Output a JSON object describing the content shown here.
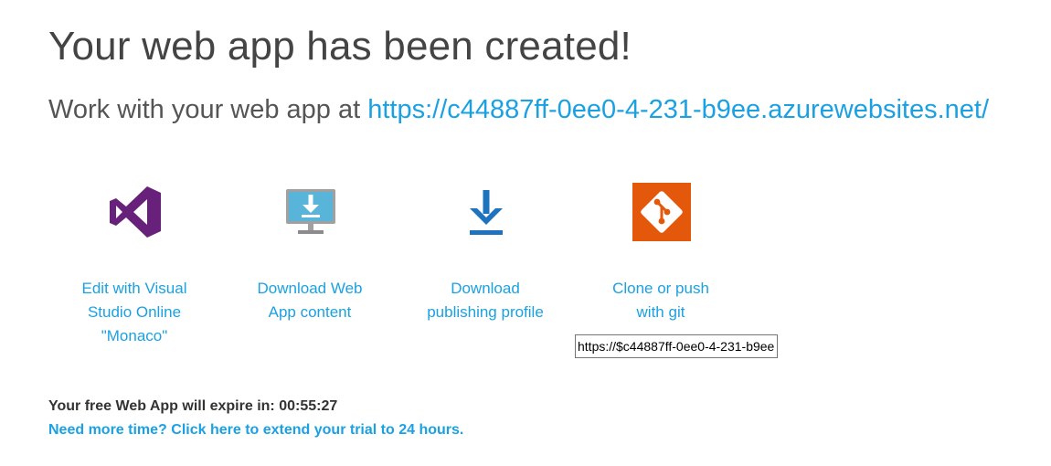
{
  "header": {
    "title": "Your web app has been created!",
    "work_with_prefix": "Work with your web app at ",
    "app_url": "https://c44887ff-0ee0-4-231-b9ee.azurewebsites.net/"
  },
  "actions": [
    {
      "line1": "Edit with Visual",
      "line2": "Studio Online",
      "line3": "\"Monaco\"",
      "icon": "visual-studio-icon"
    },
    {
      "line1": "Download Web",
      "line2": "App content",
      "icon": "download-monitor-icon"
    },
    {
      "line1": "Download",
      "line2": "publishing profile",
      "icon": "download-arrow-icon"
    },
    {
      "line1": "Clone or push",
      "line2": "with git",
      "icon": "git-icon"
    }
  ],
  "git": {
    "url_value": "https://$c44887ff-0ee0-4-231-b9ee"
  },
  "trial": {
    "expire_label": "Your free Web App will expire in: ",
    "expire_time": "00:55:27",
    "extend_link": "Need more time? Click here to extend your trial to 24 hours."
  },
  "colors": {
    "accent": "#1ba1e2",
    "vs_purple": "#68217a",
    "git_orange": "#e3580b",
    "download_blue": "#1e73be",
    "monitor_blue": "#59b4d9"
  }
}
